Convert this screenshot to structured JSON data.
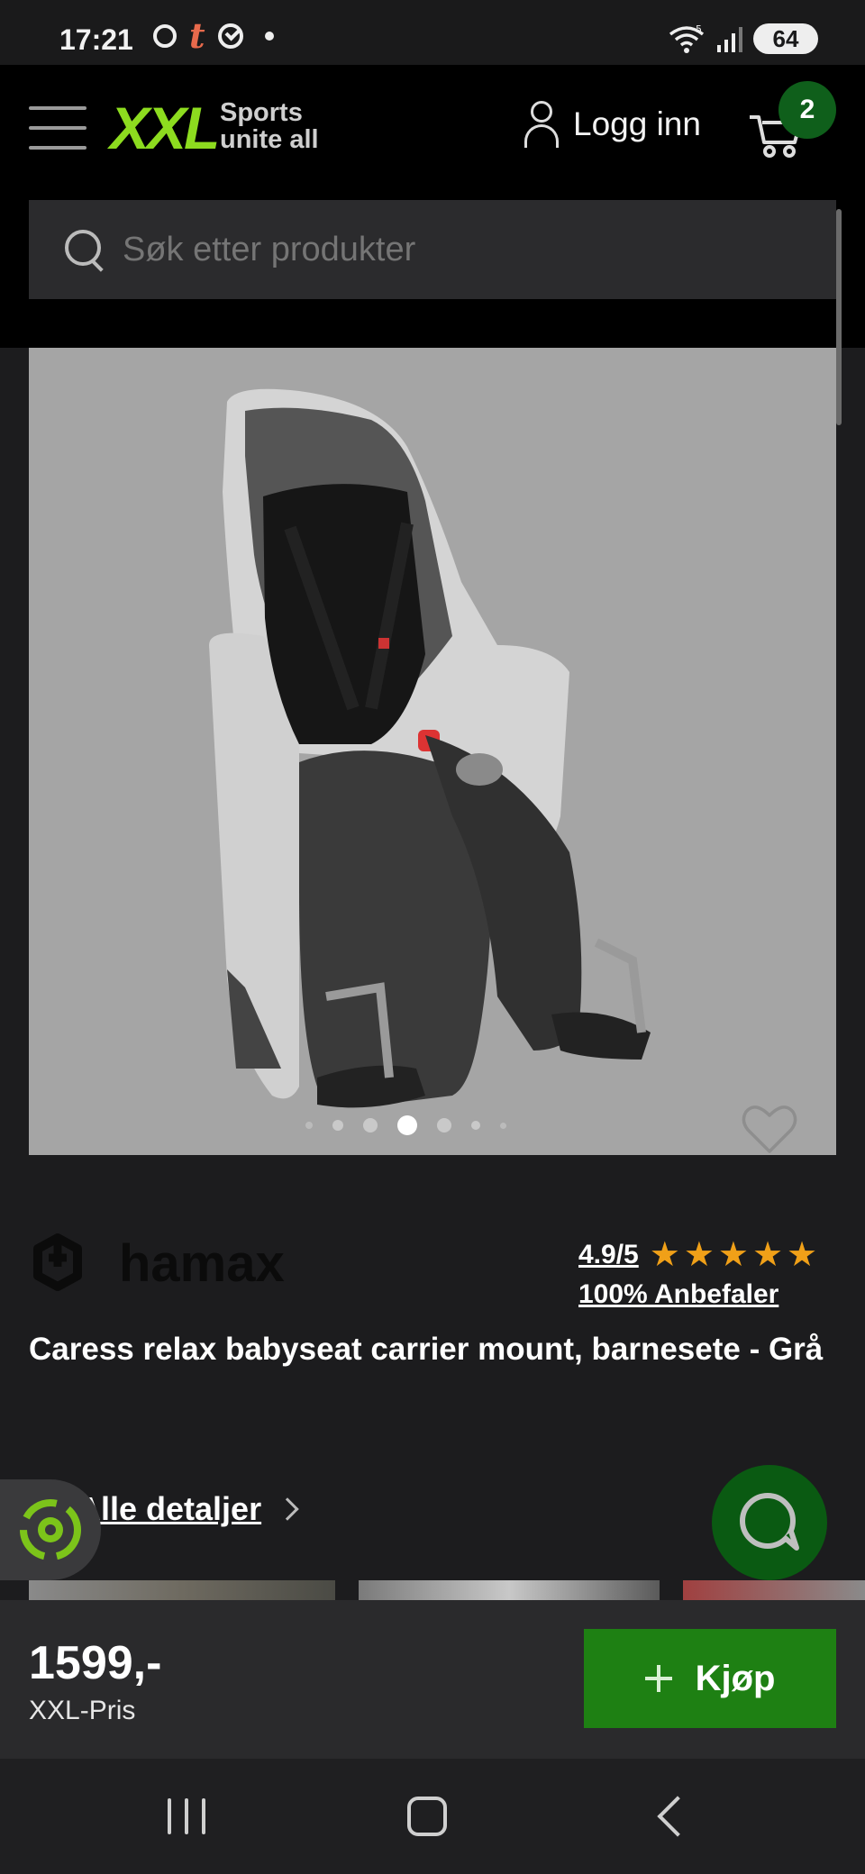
{
  "status_bar": {
    "time": "17:21",
    "notification_t": "t",
    "signal_tag": "5",
    "battery": "64"
  },
  "header": {
    "logo": "XXL",
    "tagline_line1": "Sports",
    "tagline_line2": "unite all",
    "login_label": "Logg inn",
    "cart_count": "2"
  },
  "search": {
    "placeholder": "Søk etter produkter"
  },
  "gallery": {
    "active_slide": 4,
    "slides": 7
  },
  "product": {
    "brand": "hamax",
    "rating": "4.9/5",
    "stars": 5,
    "recommend": "100% Anbefaler",
    "title": "Caress relax babyseat carrier mount, barnesete - Grå",
    "details_link": "Alle detaljer"
  },
  "buy_bar": {
    "price": "1599,-",
    "price_label": "XXL-Pris",
    "buy_label": "Kjøp"
  },
  "colors": {
    "brand_green": "#8ddc1f",
    "buy_green": "#1e8013",
    "badge_green": "#0f5f1b",
    "star": "#f0a018"
  }
}
